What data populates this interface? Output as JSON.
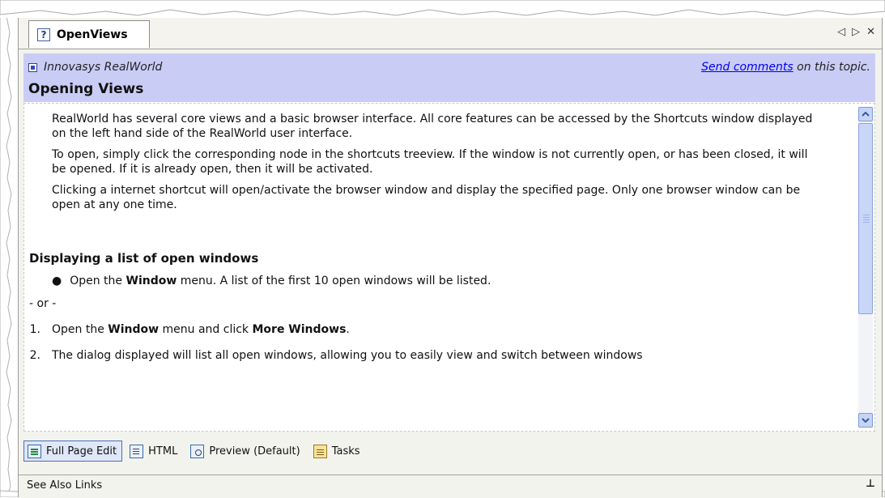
{
  "tab": {
    "title": "OpenViews",
    "help_glyph": "?",
    "nav_prev": "◁",
    "nav_next": "▷",
    "close": "✕"
  },
  "header": {
    "product": "Innovasys RealWorld",
    "send_link": "Send comments",
    "send_suffix": " on this topic.",
    "page_title": "Opening Views",
    "band_color": "#c9cdf5"
  },
  "content": {
    "paragraphs": [
      "RealWorld has several core views and a basic browser interface. All core features can be accessed by the Shortcuts window displayed on the left hand side of the RealWorld user interface.",
      "To open, simply click the corresponding node in the shortcuts treeview. If the window is not currently open, or has been closed, it will be opened. If it is already open, then it will be activated.",
      "Clicking a internet shortcut will open/activate the browser window and display the specified page. Only one browser window can be open at any one time."
    ],
    "section_heading": "Displaying a list of open windows",
    "bullet": {
      "pre": "Open the ",
      "bold": "Window",
      "post": " menu. A list of the first 10 open windows will be listed."
    },
    "or_text": "- or -",
    "steps": [
      {
        "n": "1.",
        "pre": "Open the ",
        "bold1": "Window",
        "mid": " menu and click ",
        "bold2": "More Windows",
        "post": "."
      },
      {
        "n": "2.",
        "text": "The dialog displayed will list all open windows, allowing you to easily view and switch between windows"
      }
    ]
  },
  "modes": [
    {
      "label": "Full Page Edit",
      "icon": "full-page-edit-icon",
      "active": true
    },
    {
      "label": "HTML",
      "icon": "html-view-icon",
      "active": false
    },
    {
      "label": "Preview (Default)",
      "icon": "preview-icon",
      "active": false
    },
    {
      "label": "Tasks",
      "icon": "tasks-icon",
      "active": false
    }
  ],
  "see_also": {
    "label": "See Also Links",
    "pin": "⊥"
  }
}
